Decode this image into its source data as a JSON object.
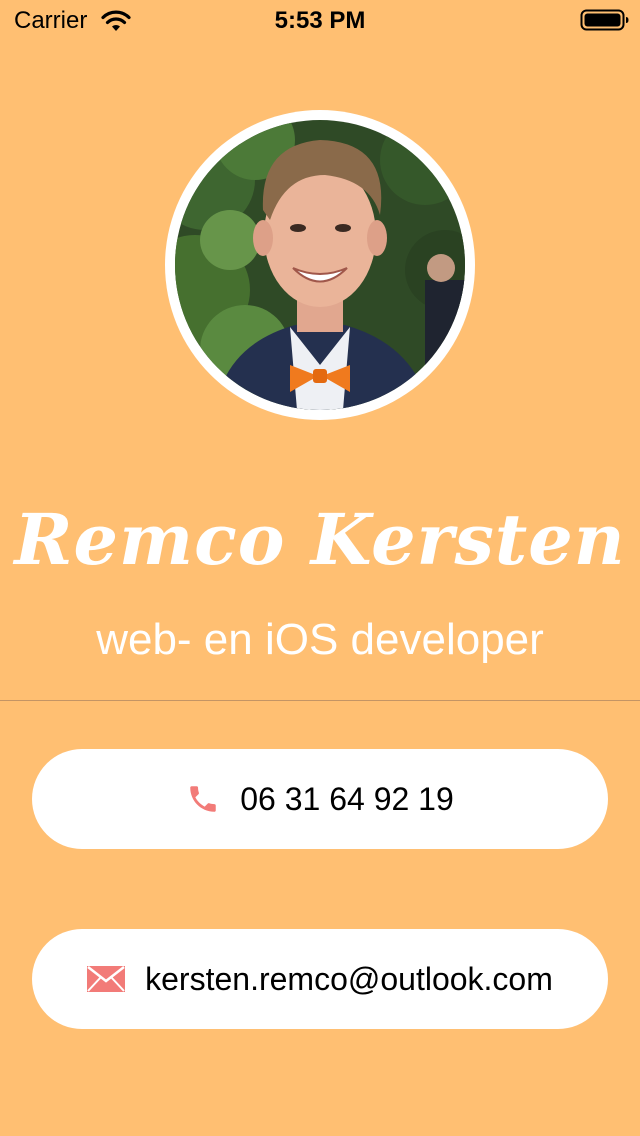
{
  "status_bar": {
    "carrier": "Carrier",
    "time": "5:53 PM",
    "icons": [
      "wifi-icon",
      "battery-icon"
    ]
  },
  "profile": {
    "photo": "profile-photo",
    "name": "Remco Kersten",
    "subtitle": "web- en iOS developer"
  },
  "contacts": {
    "phone": {
      "icon": "phone-icon",
      "value": "06 31 64 92 19"
    },
    "email": {
      "icon": "envelope-icon",
      "value": "kersten.remco@outlook.com"
    }
  },
  "colors": {
    "background": "#FFBF72",
    "card": "#FFFFFF",
    "icon_accent": "#F27B78",
    "divider": "#C49464"
  }
}
